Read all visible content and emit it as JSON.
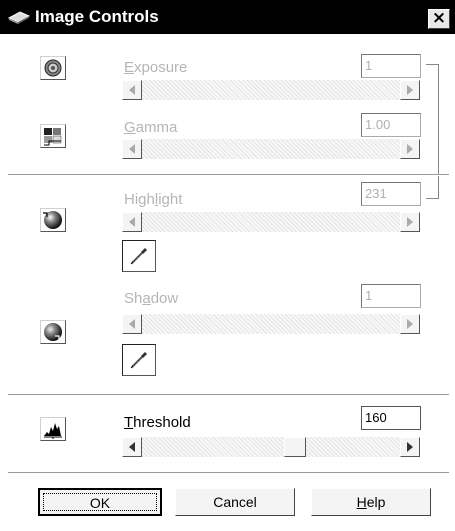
{
  "window": {
    "title": "Image Controls",
    "close_label": "×"
  },
  "exposure": {
    "label": "Exposure",
    "accesskey": "E",
    "rest": "xposure",
    "value": "1"
  },
  "gamma": {
    "label": "Gamma",
    "accesskey": "G",
    "rest": "amma",
    "value": "1.00"
  },
  "highlight": {
    "label": "Highlight",
    "pre": "High",
    "accesskey": "l",
    "rest": "ight",
    "value": "231"
  },
  "shadow": {
    "label": "Shadow",
    "pre": "Sh",
    "accesskey": "a",
    "rest": "dow",
    "value": "1"
  },
  "threshold": {
    "label": "Threshold",
    "accesskey": "T",
    "rest": "hreshold",
    "value": "160",
    "slider_fraction": 0.6
  },
  "buttons": {
    "ok": "OK",
    "cancel": "Cancel",
    "help_accesskey": "H",
    "help_rest": "elp"
  },
  "icons": {
    "title": "scanner-icon",
    "exposure": "exposure-icon",
    "gamma": "gamma-icon",
    "highlight": "highlight-ball-icon",
    "shadow": "shadow-ball-icon",
    "threshold": "histogram-icon",
    "eyedropper": "eyedropper-icon"
  }
}
